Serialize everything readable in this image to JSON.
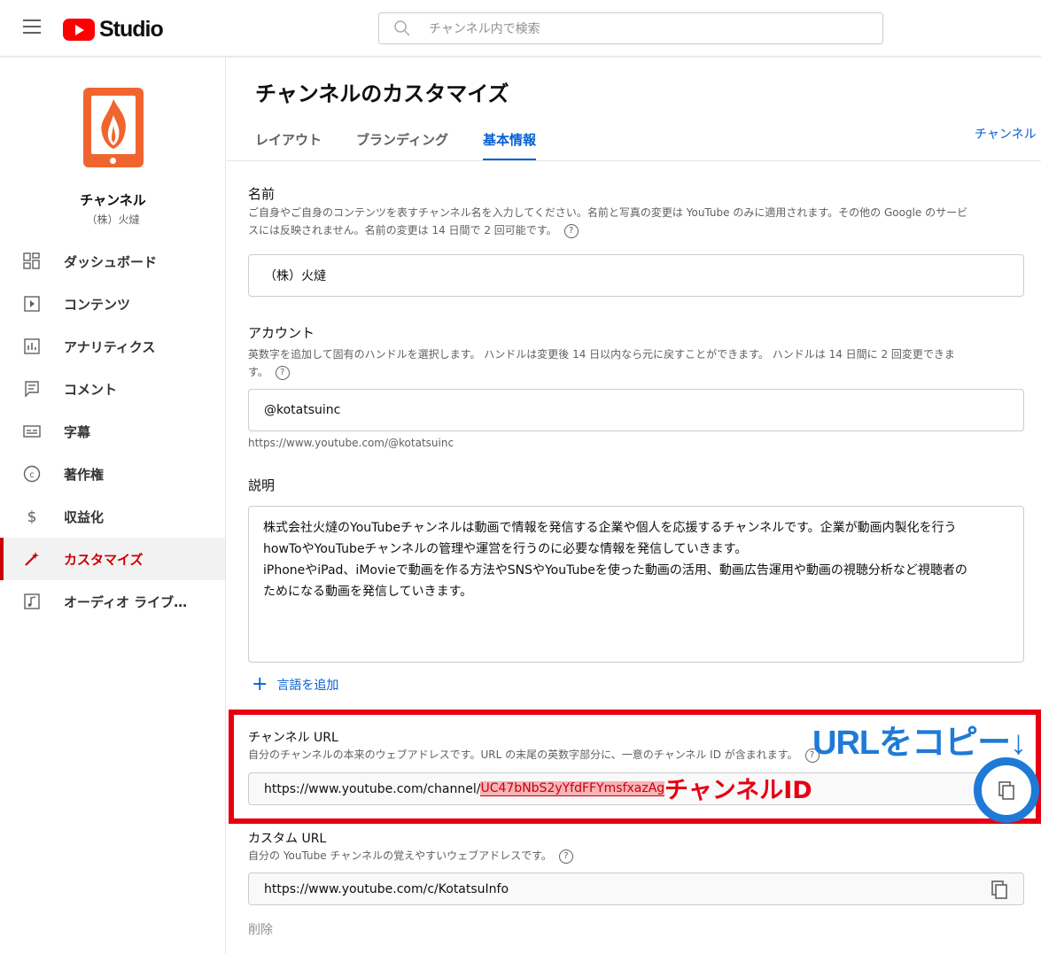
{
  "header": {
    "logo_text": "Studio",
    "search_placeholder": "チャンネル内で検索"
  },
  "sidebar": {
    "channel_label": "チャンネル",
    "channel_name": "（株）火燵",
    "items": [
      {
        "label": "ダッシュボード",
        "icon": "dashboard-icon"
      },
      {
        "label": "コンテンツ",
        "icon": "content-icon"
      },
      {
        "label": "アナリティクス",
        "icon": "analytics-icon"
      },
      {
        "label": "コメント",
        "icon": "comment-icon"
      },
      {
        "label": "字幕",
        "icon": "subtitles-icon"
      },
      {
        "label": "著作権",
        "icon": "copyright-icon"
      },
      {
        "label": "収益化",
        "icon": "dollar-icon"
      },
      {
        "label": "カスタマイズ",
        "icon": "magic-wand-icon",
        "active": true
      },
      {
        "label": "オーディオ ライブ…",
        "icon": "audio-library-icon"
      }
    ]
  },
  "main": {
    "title": "チャンネルのカスタマイズ",
    "tabs": [
      {
        "label": "レイアウト"
      },
      {
        "label": "ブランディング"
      },
      {
        "label": "基本情報"
      }
    ],
    "right_link": "チャンネル",
    "name": {
      "title": "名前",
      "desc_line1": "ご自身やご自身のコンテンツを表すチャンネル名を入力してください。名前と写真の変更は YouTube のみに適用されます。その他の Google のサービ",
      "desc_line2": "スには反映されません。名前の変更は 14 日間で 2 回可能です。",
      "value": "（株）火燵"
    },
    "account": {
      "title": "アカウント",
      "desc_line1": "英数字を追加して固有のハンドルを選択します。 ハンドルは変更後 14 日以内なら元に戻すことができます。 ハンドルは 14 日間に 2 回変更できま",
      "desc_line2": "す。",
      "value": "@kotatsuinc",
      "url": "https://www.youtube.com/@kotatsuinc"
    },
    "description": {
      "title": "説明",
      "line1": "株式会社火燵のYouTubeチャンネルは動画で情報を発信する企業や個人を応援するチャンネルです。企業が動画内製化を行う",
      "line2": "howToやYouTubeチャンネルの管理や運営を行うのに必要な情報を発信していきます。",
      "line3": "iPhoneやiPad、iMovieで動画を作る方法やSNSやYouTubeを使った動画の活用、動画広告運用や動画の視聴分析など視聴者の",
      "line4": "ためになる動画を発信していきます。"
    },
    "add_language": "言語を追加",
    "channel_url": {
      "title": "チャンネル URL",
      "desc": "自分のチャンネルの本来のウェブアドレスです。URL の末尾の英数字部分に、一意のチャンネル ID が含まれます。",
      "prefix": "https://www.youtube.com/channel/",
      "id": "UC47bNbS2yYfdFFYmsfxazAg"
    },
    "custom_url": {
      "title": "カスタム URL",
      "desc": "自分の YouTube チャンネルの覚えやすいウェブアドレスです。",
      "value": "https://www.youtube.com/c/KotatsuInfo"
    },
    "delete_label": "削除"
  },
  "annotations": {
    "copy_hint": "URLをコピー↓",
    "id_label": "チャンネルID",
    "highlight_color": "#e60012",
    "accent_color": "#1e7ad6"
  }
}
